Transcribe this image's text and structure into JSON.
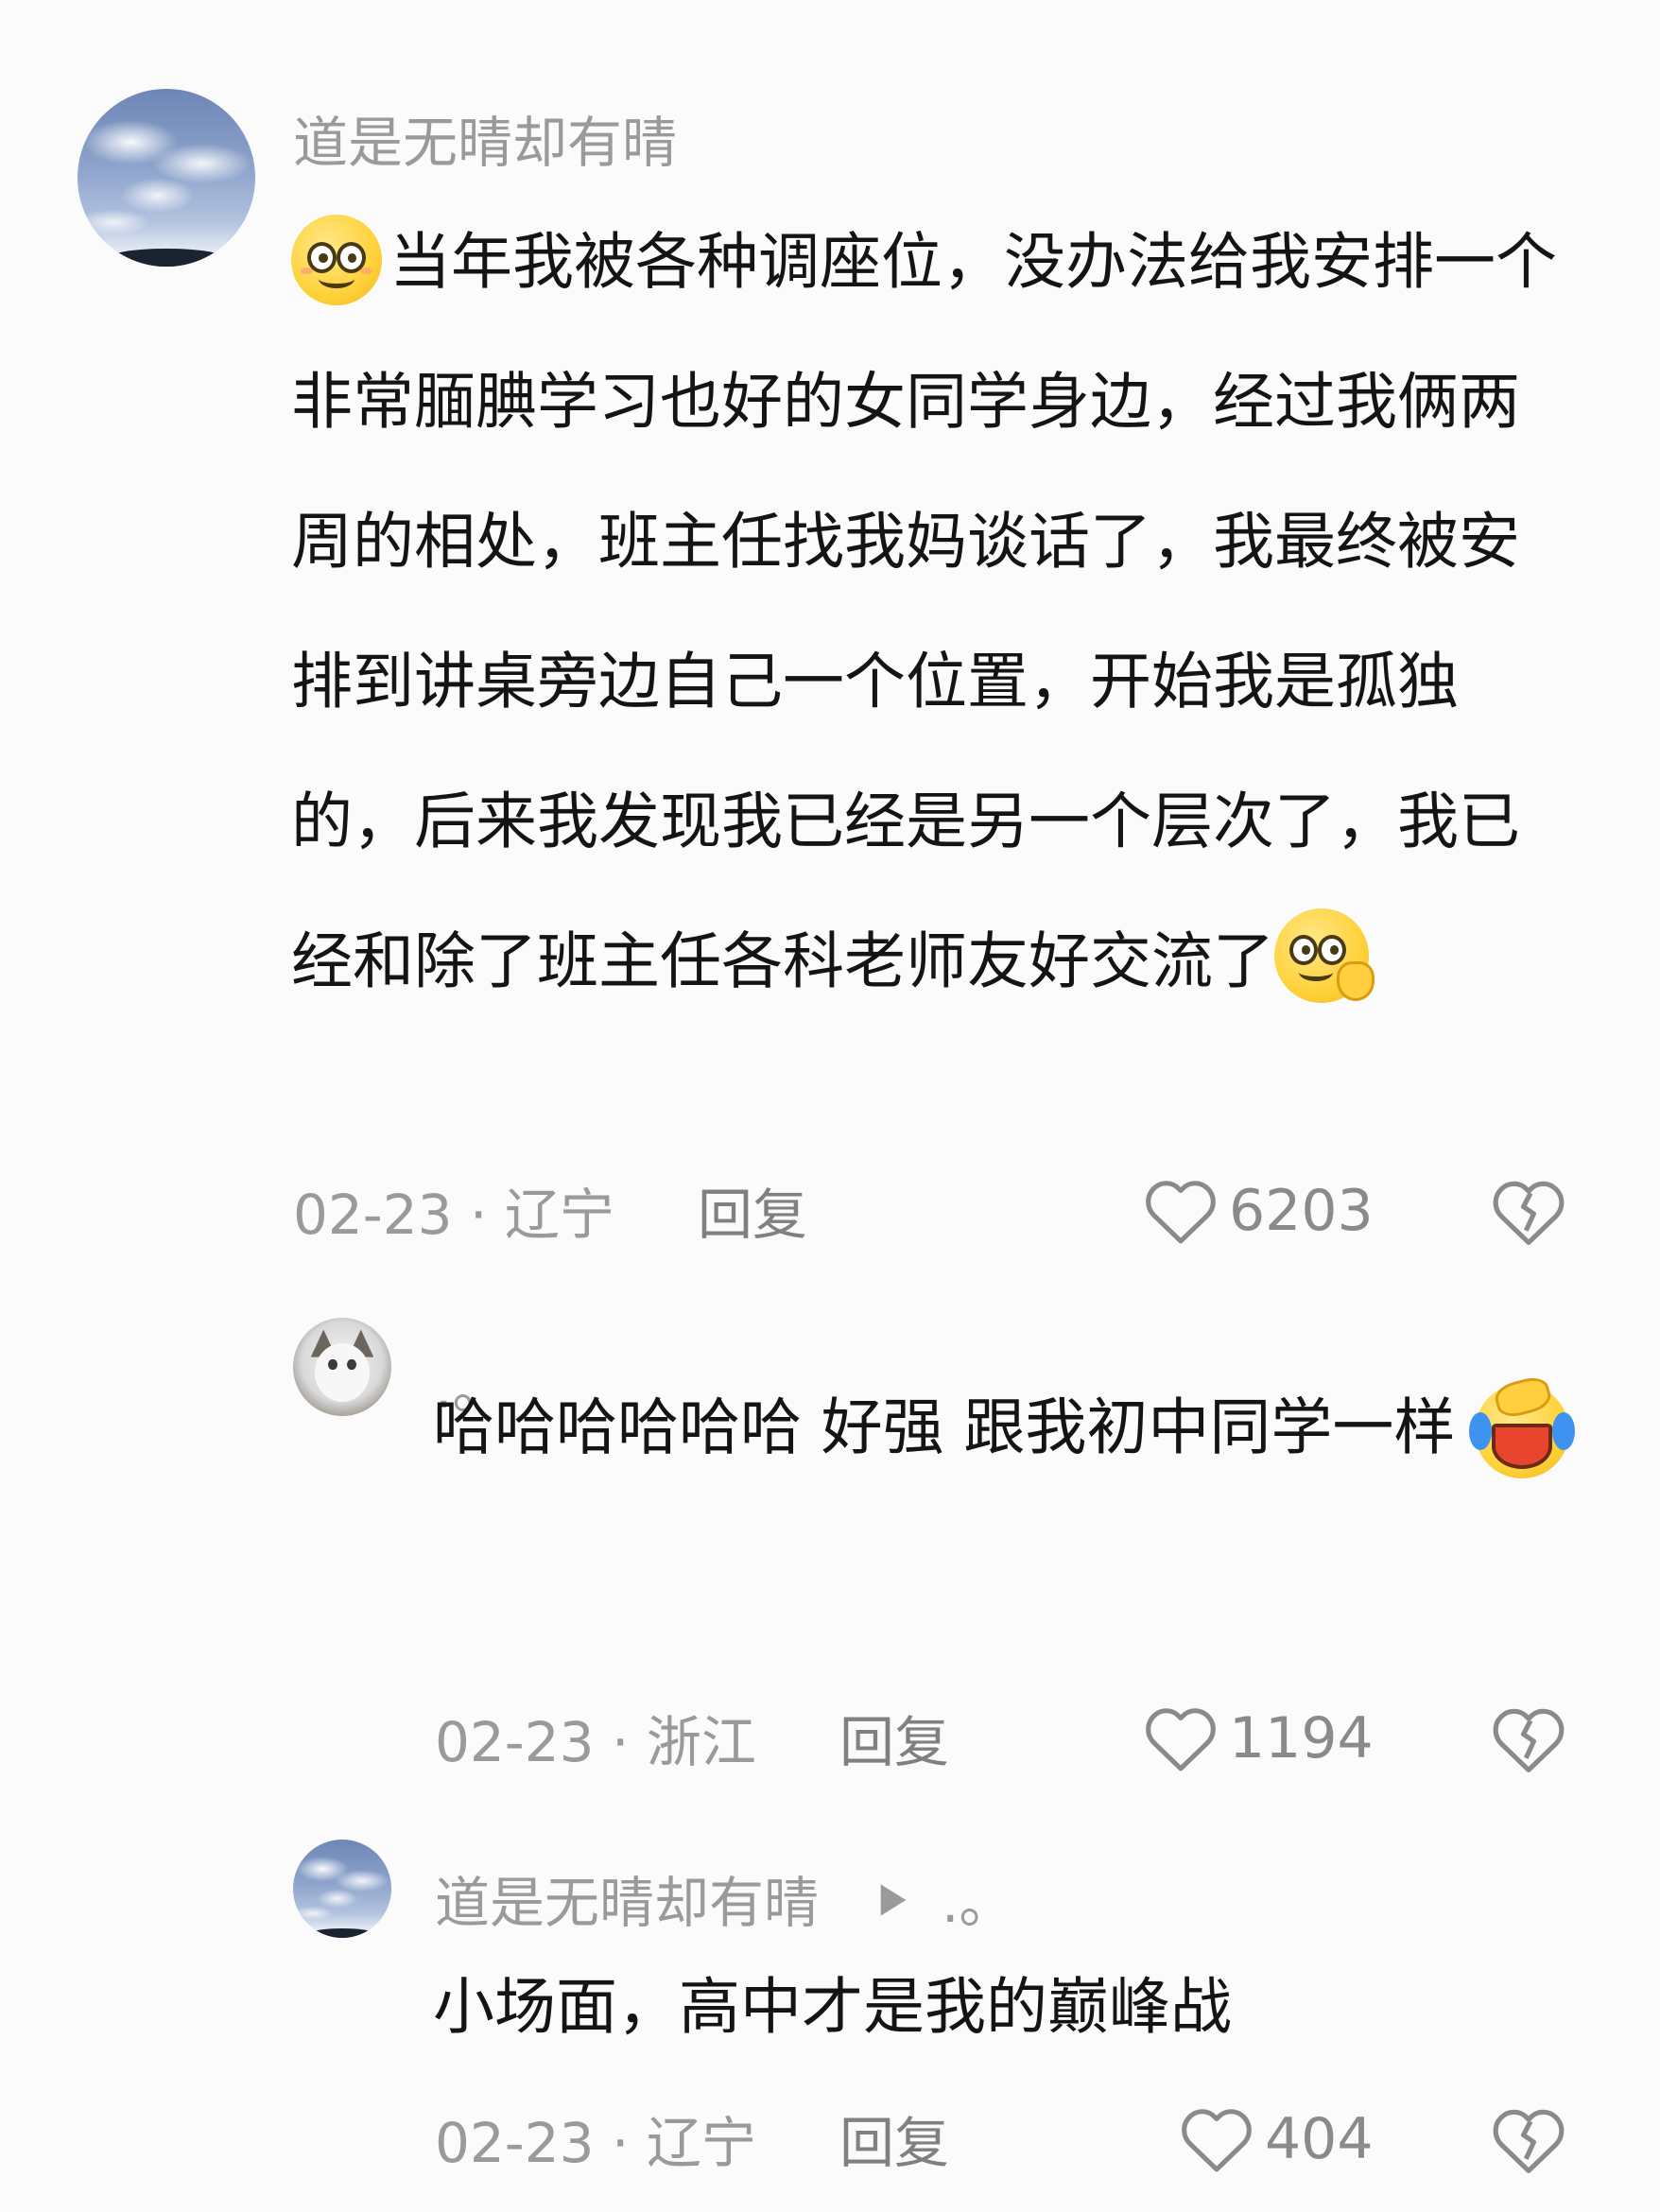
{
  "comments": [
    {
      "author": "道是无晴却有晴",
      "text": "当年我被各种调座位，没办法给我安排一个非常腼腆学习也好的女同学身边，经过我俩两周的相处，班主任找我妈谈话了，我最终被安排到讲桌旁边自己一个位置，开始我是孤独的，后来我发现我已经是另一个层次了，我已经和除了班主任各科老师友好交流了",
      "meta": "02-23 · 辽宁",
      "reply_label": "回复",
      "likes": "6203",
      "lead_emoji": "smile-emoji",
      "trail_emoji": "cute-emoji"
    },
    {
      "author": ".。",
      "text": "哈哈哈哈哈哈 好强 跟我初中同学一样",
      "meta": "02-23 · 浙江",
      "reply_label": "回复",
      "likes": "1194",
      "trail_emoji": "laugh-cry-emoji"
    },
    {
      "author": "道是无晴却有晴",
      "reply_to": ".。",
      "text": "小场面，高中才是我的巅峰战",
      "meta": "02-23 · 辽宁",
      "reply_label": "回复",
      "likes": "404"
    }
  ],
  "colors": {
    "background": "#fbfbfb",
    "text": "#141414",
    "muted": "#9a9a9a",
    "icon": "#8a8a8a"
  }
}
